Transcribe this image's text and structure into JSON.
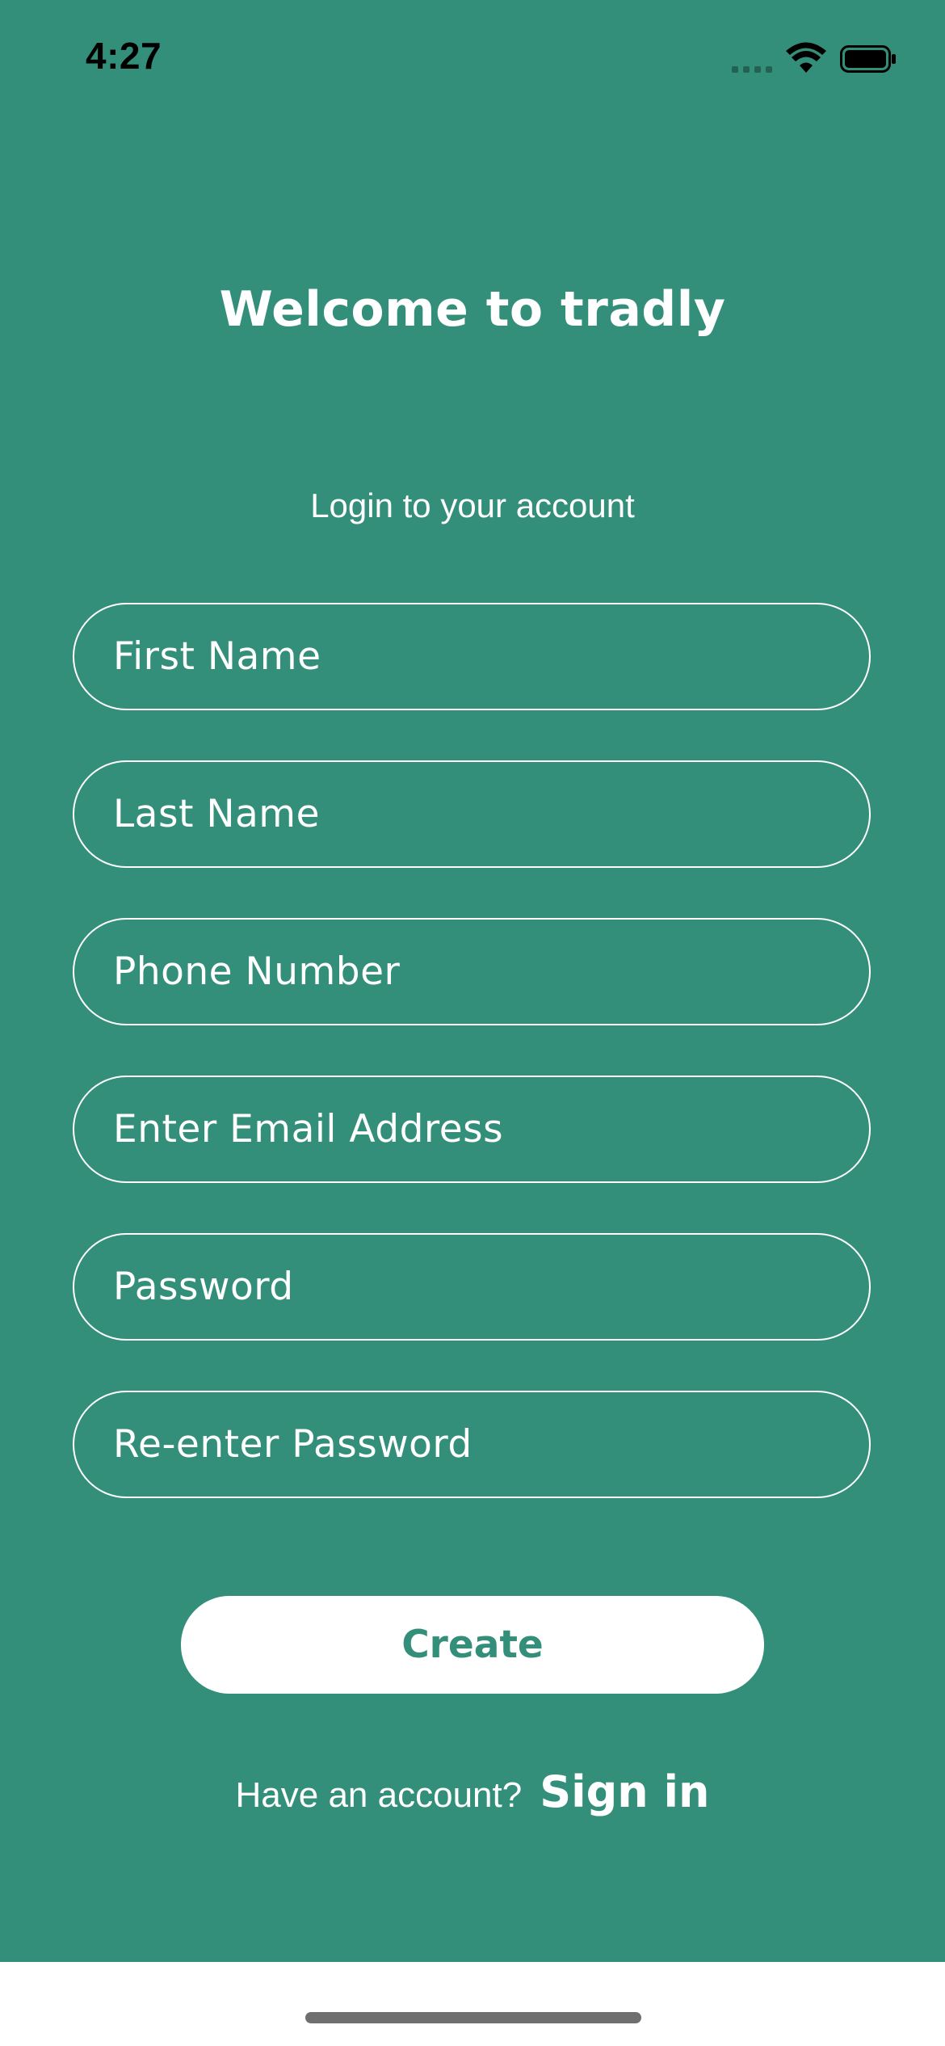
{
  "status_bar": {
    "time": "4:27"
  },
  "header": {
    "title": "Welcome to tradly",
    "subtitle": "Login to your account"
  },
  "form": {
    "first_name_placeholder": "First Name",
    "last_name_placeholder": "Last Name",
    "phone_placeholder": "Phone Number",
    "email_placeholder": "Enter Email Address",
    "password_placeholder": "Password",
    "reenter_password_placeholder": "Re-enter Password",
    "first_name_value": "",
    "last_name_value": "",
    "phone_value": "",
    "email_value": "",
    "password_value": "",
    "reenter_password_value": ""
  },
  "actions": {
    "create_label": "Create",
    "have_account_text": "Have an account?",
    "sign_in_label": "Sign in"
  },
  "colors": {
    "background": "#338F7A",
    "text": "#FFFFFF",
    "button_bg": "#FFFFFF",
    "button_text": "#338F7A"
  },
  "icons": [
    "cellular-signal-icon",
    "wifi-icon",
    "battery-icon"
  ]
}
